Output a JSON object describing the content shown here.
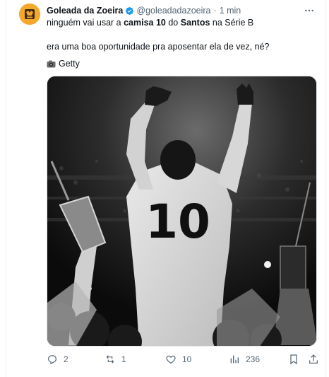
{
  "tweet": {
    "author_name": "Goleada da Zoeira",
    "handle": "@goleadadazoeira",
    "separator": "·",
    "time": "1 min",
    "line1": {
      "pre": "ninguém vai usar a ",
      "bold1": "camisa 10",
      "mid": " do ",
      "bold2": "Santos",
      "post": " na Série B"
    },
    "line2": "era uma boa oportunidade pra aposentar ela de vez, né?",
    "credit": "Getty",
    "photo_jersey_number": "10"
  },
  "actions": {
    "replies": "2",
    "reposts": "1",
    "likes": "10",
    "views": "236"
  },
  "icons": [
    "logo-avatar",
    "verified-badge-icon",
    "more-options-icon",
    "camera-icon",
    "reply-icon",
    "repost-icon",
    "like-icon",
    "views-icon",
    "bookmark-icon",
    "share-icon"
  ],
  "colors": {
    "verified": "#1d9bf0",
    "secondary_text": "#536471",
    "avatar": "#f5a82a"
  }
}
